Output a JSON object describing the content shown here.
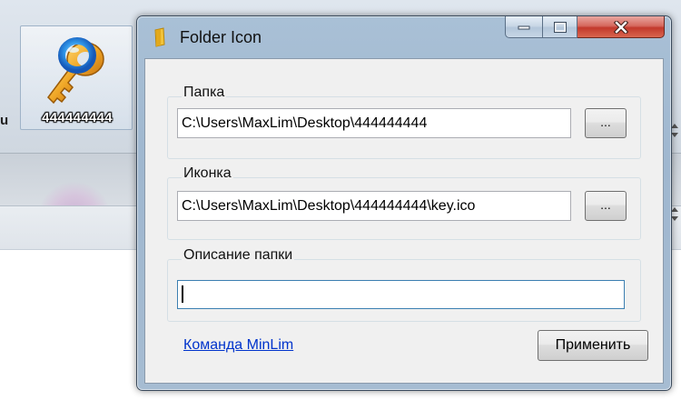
{
  "desktop": {
    "icon_label": "444444444",
    "edge_text": "u"
  },
  "window": {
    "title": "Folder Icon",
    "buttons": {
      "minimize_icon": "minimize-icon",
      "maximize_icon": "maximize-icon",
      "close_icon": "close-icon"
    }
  },
  "folder_group": {
    "label": "Папка",
    "value": "C:\\Users\\MaxLim\\Desktop\\444444444",
    "browse_label": "..."
  },
  "icon_group": {
    "label": "Иконка",
    "value": "C:\\Users\\MaxLim\\Desktop\\444444444\\key.ico",
    "browse_label": "..."
  },
  "description_group": {
    "label": "Описание папки",
    "value": ""
  },
  "footer": {
    "link_text": "Команда MinLim",
    "apply_label": "Применить"
  },
  "colors": {
    "link": "#0033cc",
    "close_button": "#c2392c",
    "title_bar": "#a9c0d6"
  }
}
